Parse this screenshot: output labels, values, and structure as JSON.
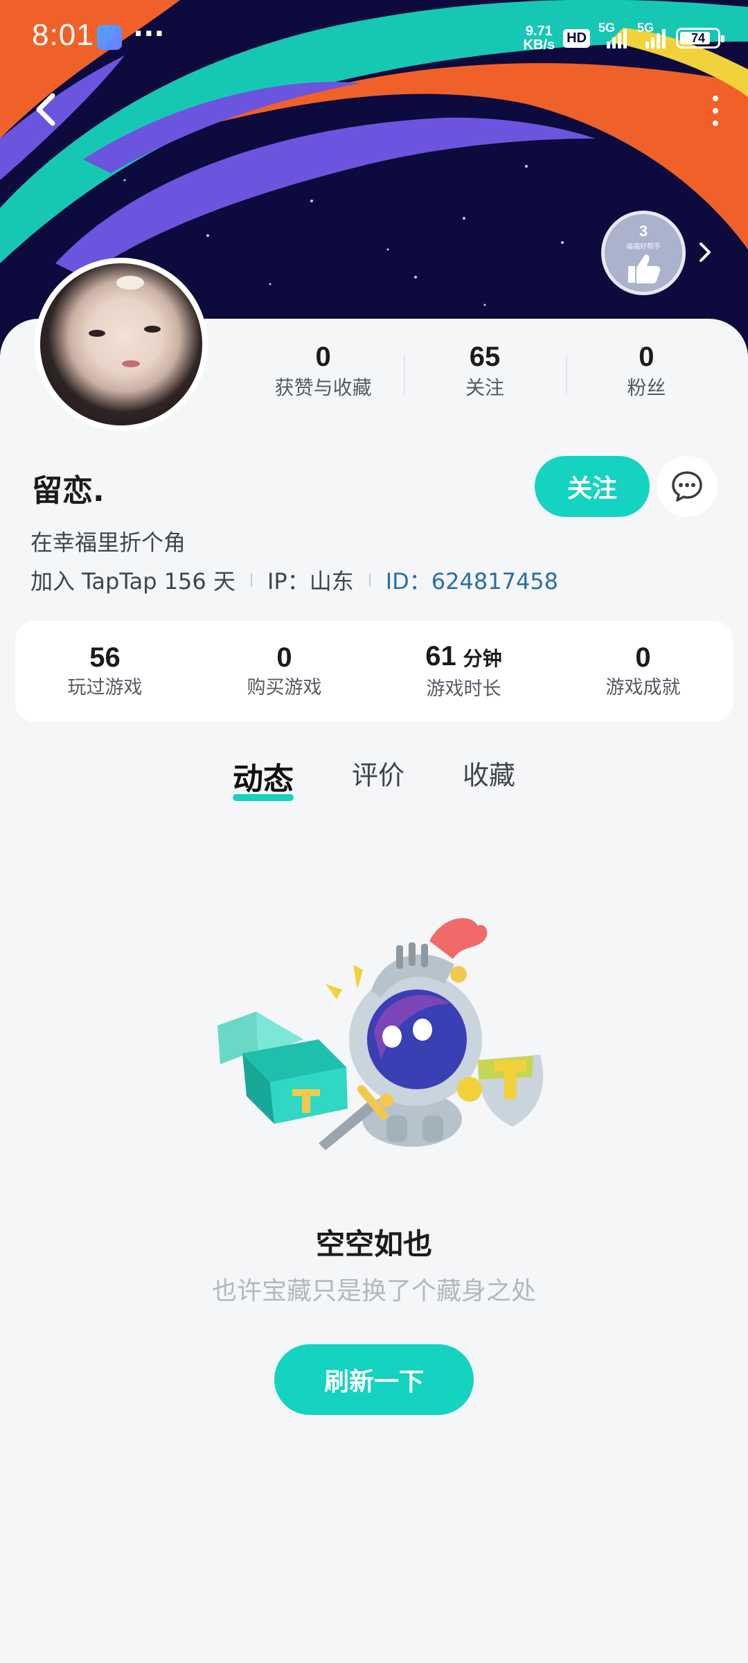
{
  "status_bar": {
    "time": "8:01",
    "more": "···",
    "net_speed_value": "9.71",
    "net_speed_unit": "KB/s",
    "hd_badge": "HD",
    "signal_1": "5G",
    "signal_2": "5G",
    "battery": "74"
  },
  "header": {
    "back_icon": "chevron-left-icon",
    "more_icon": "more-vertical-icon",
    "medal_count": "3",
    "medal_caption": "福福好帮手"
  },
  "profile": {
    "username": "留恋.",
    "follow_label": "关注",
    "bio": "在幸福里折个角",
    "join_text": "加入 TapTap 156 天",
    "ip_text": "IP：山东",
    "id_text": "ID：624817458",
    "stats": [
      {
        "value": "0",
        "label": "获赞与收藏"
      },
      {
        "value": "65",
        "label": "关注"
      },
      {
        "value": "0",
        "label": "粉丝"
      }
    ]
  },
  "game_stats": [
    {
      "value": "56",
      "unit": "",
      "label": "玩过游戏"
    },
    {
      "value": "0",
      "unit": "",
      "label": "购买游戏"
    },
    {
      "value": "61",
      "unit": "分钟",
      "label": "游戏时长"
    },
    {
      "value": "0",
      "unit": "",
      "label": "游戏成就"
    }
  ],
  "tabs": [
    {
      "label": "动态",
      "active": true
    },
    {
      "label": "评价",
      "active": false
    },
    {
      "label": "收藏",
      "active": false
    }
  ],
  "empty_state": {
    "title": "空空如也",
    "subtitle": "也许宝藏只是换了个藏身之处",
    "refresh_label": "刷新一下"
  },
  "colors": {
    "accent": "#14d3c0",
    "id_link": "#2a6da8",
    "banner_bg": "#0d0a3d"
  }
}
